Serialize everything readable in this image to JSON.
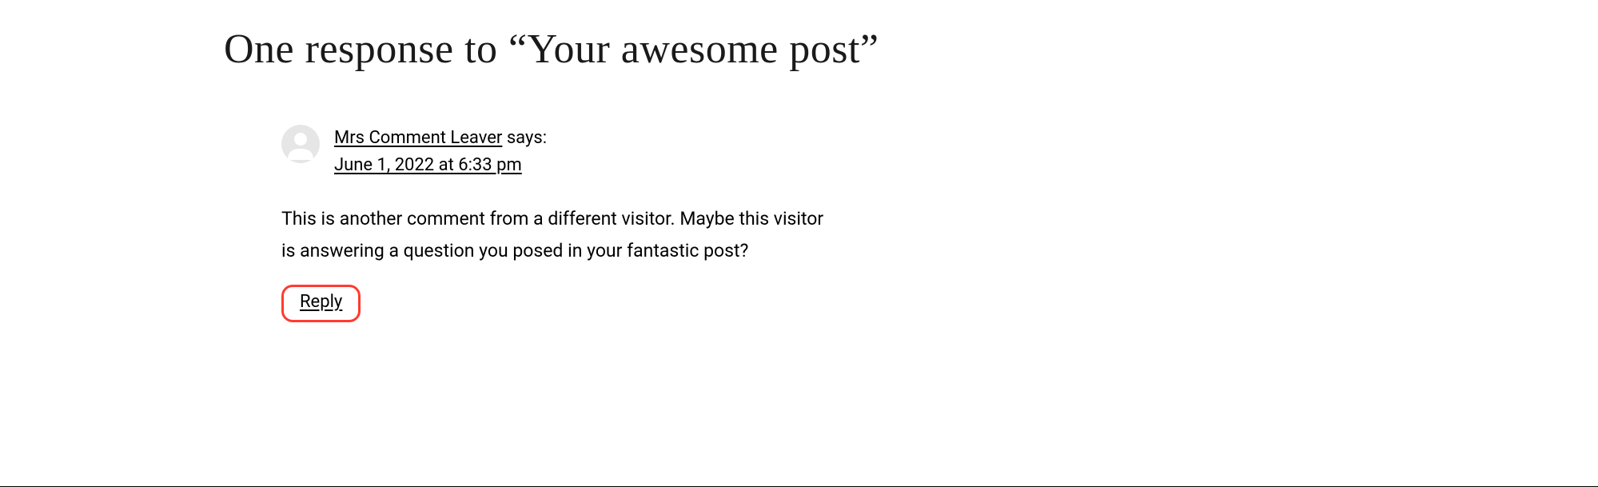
{
  "heading": "One response to “Your awesome post”",
  "comment": {
    "author": "Mrs Comment Leaver",
    "says": " says:",
    "timestamp": "June 1, 2022 at 6:33 pm",
    "body": "This is another comment from a different visitor. Maybe this visitor is answering a question you posed in your fantastic post?",
    "reply_label": "Reply"
  }
}
